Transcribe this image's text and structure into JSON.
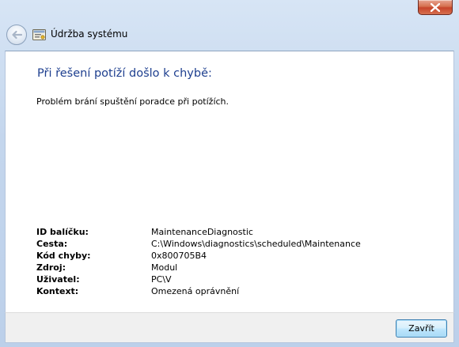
{
  "window": {
    "title": "Údržba systému"
  },
  "content": {
    "heading": "Při řešení potíží došlo k chybě:",
    "message": "Problém brání spuštění poradce při potížích.",
    "details": [
      {
        "label": "ID balíčku:",
        "value": "MaintenanceDiagnostic"
      },
      {
        "label": "Cesta:",
        "value": "C:\\Windows\\diagnostics\\scheduled\\Maintenance"
      },
      {
        "label": "Kód chyby:",
        "value": "0x800705B4"
      },
      {
        "label": "Zdroj:",
        "value": "Modul"
      },
      {
        "label": "Uživatel:",
        "value": "PC\\V"
      },
      {
        "label": "Kontext:",
        "value": "Omezená oprávnění"
      }
    ]
  },
  "footer": {
    "close_label": "Zavřít"
  },
  "icons": {
    "close": "close-icon",
    "back": "back-arrow-icon",
    "app": "maintenance-icon"
  },
  "colors": {
    "heading": "#1e3f8f",
    "close_button": "#c7442a",
    "frame": "#c4d6ed"
  }
}
